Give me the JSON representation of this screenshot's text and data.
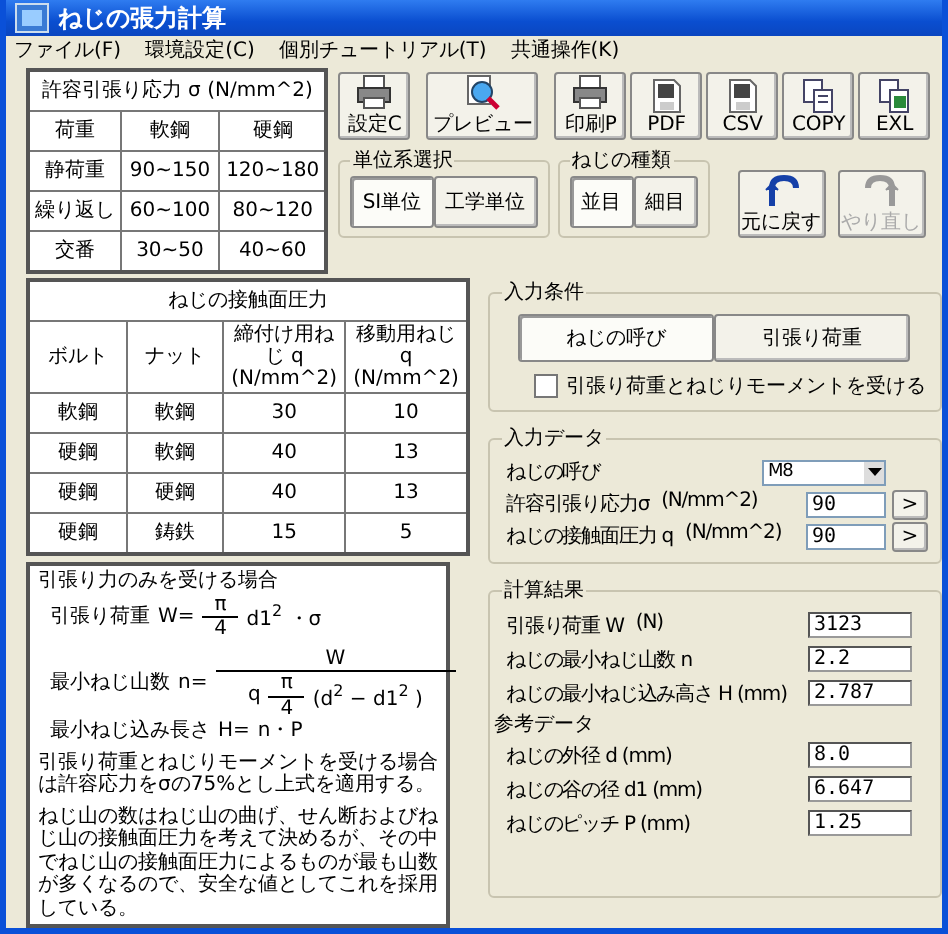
{
  "window": {
    "title": "ねじの張力計算"
  },
  "menu": [
    "ファイル(F)",
    "環境設定(C)",
    "個別チュートリアル(T)",
    "共通操作(K)"
  ],
  "stress_table": {
    "title": "許容引張り応力 σ (N/mm^2)",
    "columns": [
      "荷重",
      "軟鋼",
      "硬鋼"
    ],
    "rows": [
      [
        "静荷重",
        "90~150",
        "120~180"
      ],
      [
        "繰り返し",
        "60~100",
        "80~120"
      ],
      [
        "交番",
        "30~50",
        "40~60"
      ]
    ]
  },
  "toolbar": [
    {
      "kind": "printer",
      "label": "設定C"
    },
    {
      "kind": "preview",
      "label": "プレビュー"
    },
    {
      "kind": "printer",
      "label": "印刷P"
    },
    {
      "kind": "disk",
      "label": "PDF"
    },
    {
      "kind": "disk",
      "label": "CSV"
    },
    {
      "kind": "copy",
      "label": "COPY"
    },
    {
      "kind": "excel",
      "label": "EXL"
    }
  ],
  "units": {
    "title": "単位系選択",
    "options": [
      {
        "label": "SI単位",
        "selected": true
      },
      {
        "label": "工学単位",
        "selected": false
      }
    ]
  },
  "screw_type": {
    "title": "ねじの種類",
    "options": [
      {
        "label": "並目",
        "selected": true
      },
      {
        "label": "細目",
        "selected": false
      }
    ]
  },
  "history_buttons": [
    {
      "kind": "undo",
      "label": "元に戻す",
      "disabled": false
    },
    {
      "kind": "redo",
      "label": "やり直し",
      "disabled": true
    }
  ],
  "pressure_table": {
    "title": "ねじの接触面圧力",
    "columns": [
      "ボルト",
      "ナット",
      "締付け用ねじ q (N/mm^2)",
      "移動用ねじ q (N/mm^2)"
    ],
    "rows": [
      [
        "軟鋼",
        "軟鋼",
        "30",
        "10"
      ],
      [
        "硬鋼",
        "軟鋼",
        "40",
        "13"
      ],
      [
        "硬鋼",
        "硬鋼",
        "40",
        "13"
      ],
      [
        "硬鋼",
        "鋳鉄",
        "15",
        "5"
      ]
    ]
  },
  "formula": {
    "heading": "引張り力のみを受ける場合",
    "load": {
      "label": "引張り荷重",
      "lhs": "W=",
      "num": "π",
      "den": "4",
      "tail": "d1$^{2}$ ・σ"
    },
    "threads": {
      "label": "最小ねじ山数",
      "lhs": "n=",
      "num": "W",
      "den_prefix": "q",
      "den_num": "π",
      "den_den": "4",
      "den_tail": "(d$^{2}$ − d1$^{2}$ )"
    },
    "length": {
      "label": "最小ねじ込み長さ",
      "lhs": "H=",
      "rhs": "n・P"
    },
    "notes": [
      "引張り荷重とねじりモーメントを受ける場合は許容応力をσの75%とし上式を適用する。",
      "ねじ山の数はねじ山の曲げ、せん断およびねじ山の接触面圧力を考えて決めるが、その中でねじ山の接触面圧力によるものが最も山数が多くなるので、安全な値としてこれを採用している。"
    ]
  },
  "input_conditions": {
    "title": "入力条件",
    "options": [
      {
        "label": "ねじの呼び",
        "selected": true
      },
      {
        "label": "引張り荷重",
        "selected": false
      }
    ],
    "checkbox": {
      "label": "引張り荷重とねじりモーメントを受ける",
      "checked": false
    }
  },
  "input_data": {
    "title": "入力データ",
    "fields": [
      {
        "kind": "select",
        "label": "ねじの呼び",
        "value": "M8"
      },
      {
        "kind": "input",
        "label": "許容引張り応力σ",
        "unit": "(N/mm^2)",
        "value": "90",
        "button": ">"
      },
      {
        "kind": "input",
        "label": "ねじの接触面圧力 q",
        "unit": "(N/mm^2)",
        "value": "90",
        "button": ">"
      }
    ]
  },
  "results": {
    "title": "計算結果",
    "rows": [
      {
        "label": "引張り荷重 W",
        "unit": "(N)",
        "value": "3123"
      },
      {
        "label": "ねじの最小ねじ山数 n",
        "value": "2.2"
      },
      {
        "label": "ねじの最小ねじ込み高さ H (mm)",
        "value": "2.787"
      }
    ],
    "reference_title": "参考データ",
    "reference_rows": [
      {
        "label": "ねじの外径 d (mm)",
        "value": "8.0"
      },
      {
        "label": "ねじの谷の径 d1 (mm)",
        "value": "6.647"
      },
      {
        "label": "ねじのピッチ P (mm)",
        "value": "1.25"
      }
    ]
  }
}
